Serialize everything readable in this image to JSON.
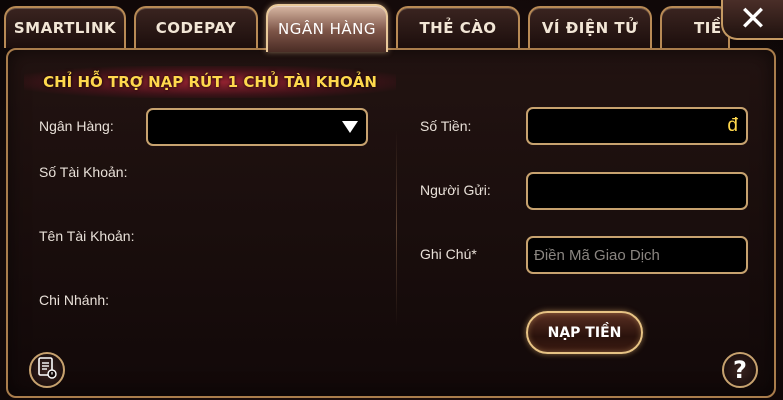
{
  "tabs": [
    {
      "label": "SMARTLINK",
      "active": false
    },
    {
      "label": "CODEPAY",
      "active": false
    },
    {
      "label": "NGÂN HÀNG",
      "active": true
    },
    {
      "label": "THẺ CÀO",
      "active": false
    },
    {
      "label": "VÍ ĐIỆN TỬ",
      "active": false
    },
    {
      "label": "TIỀ",
      "active": false
    }
  ],
  "notice": "CHỈ HỖ TRỢ NẠP RÚT 1 CHỦ TÀI KHOẢN",
  "left_form": {
    "bank_label": "Ngân Hàng:",
    "bank_value": "",
    "account_number_label": "Số Tài Khoản:",
    "account_name_label": "Tên Tài Khoản:",
    "branch_label": "Chi Nhánh:"
  },
  "right_form": {
    "amount_label": "Số Tiền:",
    "amount_value": "",
    "currency_symbol": "đ",
    "sender_label": "Người Gửi:",
    "sender_value": "",
    "note_label": "Ghi Chú*",
    "note_value": "",
    "note_placeholder": "Điền Mã Giao Dịch",
    "submit_label": "NẠP TIỀN"
  },
  "icons": {
    "close": "close-icon",
    "history": "history-icon",
    "help": "help-icon",
    "dropdown": "chevron-down-icon"
  },
  "colors": {
    "accent_gold": "#c7a26f",
    "notice_text": "#ffd84d",
    "currency": "#ffd84d"
  }
}
